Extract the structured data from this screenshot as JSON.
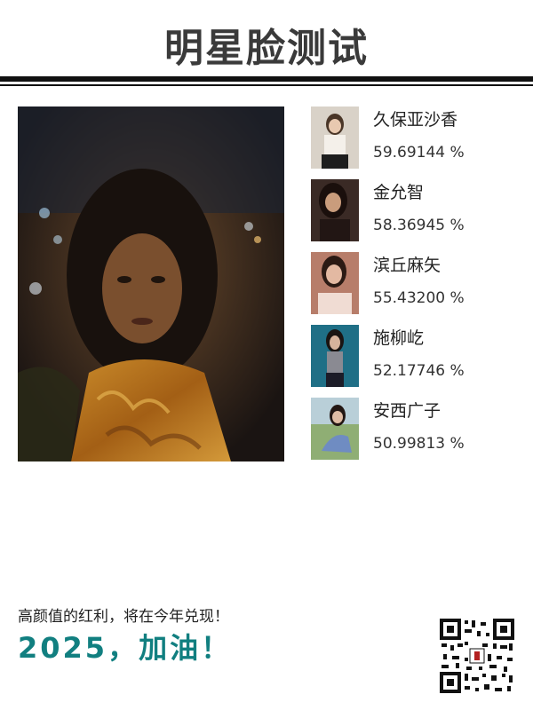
{
  "header": {
    "title": "明星脸测试"
  },
  "matches": [
    {
      "name": "久保亚沙香",
      "score": "59.69144 %"
    },
    {
      "name": "金允智",
      "score": "58.36945 %"
    },
    {
      "name": "滨丘麻矢",
      "score": "55.43200 %"
    },
    {
      "name": "施柳屹",
      "score": "52.17746 %"
    },
    {
      "name": "安西广子",
      "score": "50.99813 %"
    }
  ],
  "footer": {
    "text": "高颜值的红利，将在今年兑现！",
    "slogan": "2025，加油！"
  },
  "colors": {
    "accent": "#117f80",
    "bar": "#111111"
  },
  "icons": {
    "qr": "qr-code-icon"
  }
}
